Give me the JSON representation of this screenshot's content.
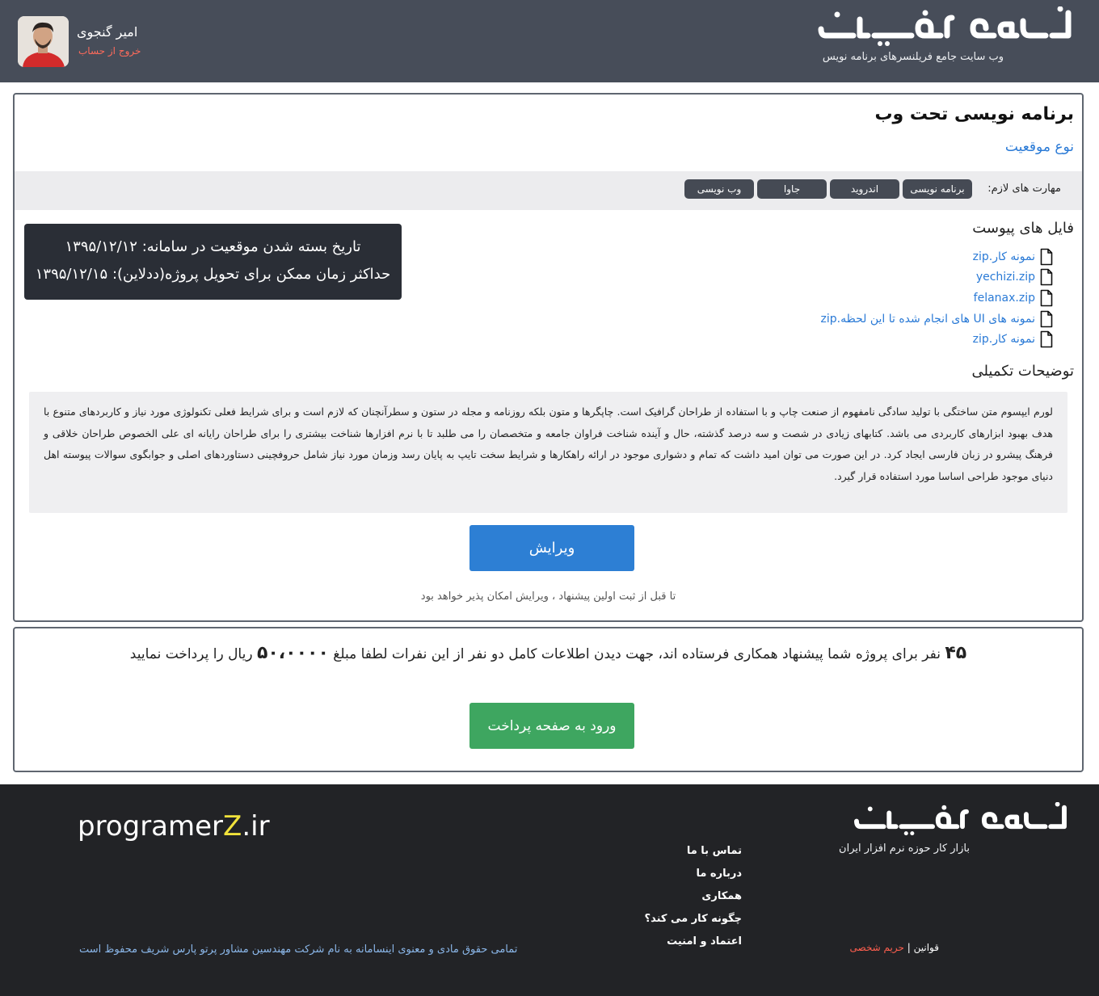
{
  "header": {
    "brand_logo_text": "برنامه نویسان",
    "tagline": "وب سایت جامع فریلنسرهای برنامه نویس",
    "user_name": "امیر گنجوی",
    "logout_label": "خروج از حساب"
  },
  "project": {
    "title": "برنامه نویسی تحت وب",
    "position_type": "نوع موقعیت",
    "skills_label": "مهارت های لازم:",
    "skills": [
      "برنامه نویسی",
      "اندروید",
      "جاوا",
      "وب نویسی"
    ],
    "close_date_line": "تاریخ بسته شدن موقعیت در سامانه: ۱۳۹۵/۱۲/۱۲",
    "deadline_line": "حداکثر زمان ممکن برای تحویل پروژه(ددلاین): ۱۳۹۵/۱۲/۱۵",
    "files_title": "فایل های پیوست",
    "files": [
      "نمونه کار.zip",
      "yechizi.zip",
      "felanax.zip",
      "نمونه های UI های انجام شده تا این لحظه.zip",
      "نمونه کار.zip"
    ],
    "notes_title": "توضیحات تکمیلی",
    "notes_text": "لورم ایپسوم متن ساختگی با تولید سادگی نامفهوم از صنعت چاپ و با استفاده از طراحان گرافیک است. چاپگرها و متون بلکه روزنامه و مجله در ستون و سطرآنچنان که لازم است و برای شرایط فعلی تکنولوژی مورد نیاز و کاربردهای متنوع با هدف بهبود ابزارهای کاربردی می باشد. کتابهای زیادی در شصت و سه درصد گذشته، حال و آینده شناخت فراوان جامعه و متخصصان را می طلبد تا با نرم افزارها شناخت بیشتری را برای طراحان رایانه ای علی الخصوص طراحان خلاقی و فرهنگ پیشرو در زبان فارسی ایجاد کرد. در این صورت می توان امید داشت که تمام و دشواری موجود در ارائه راهکارها و شرایط سخت تایپ به پایان رسد وزمان مورد نیاز شامل حروفچینی دستاوردهای اصلی و جوابگوی سوالات پیوسته اهل دنیای موجود طراحی اساسا مورد استفاده قرار گیرد.",
    "edit_label": "ویرایش",
    "edit_note": "تا قبل از ثبت اولین پیشنهاد ، ویرایش امکان پذیر خواهد بود"
  },
  "payment": {
    "count": "۴۵",
    "text_before_amount": "نفر برای پروژه شما پیشنهاد همکاری فرستاده اند، جهت دیدن اطلاعات کامل دو نفر از این نفرات لطفا مبلغ",
    "amount": "۵۰،۰۰۰۰",
    "text_after_amount": "ریال را پرداخت نمایید",
    "button_label": "ورود به صفحه پرداخت"
  },
  "footer": {
    "brand_logo_text": "برنامه نویسان",
    "tagline": "بازار کار حوزه نرم افزار ایران",
    "domain_prefix": "programer",
    "domain_accent": "Z",
    "domain_suffix": ".ir",
    "links": [
      "تماس با ما",
      "درباره ما",
      "همکاری",
      "چگونه کار می کند؟",
      "اعتماد و امنیت"
    ],
    "rules_label": "قوانین",
    "separator": "|",
    "privacy_label": "حریم شخصی",
    "copyright": "تمامی حقوق مادی و معنوی اینسامانه به نام شرکت مهندسین مشاور پرتو پارس شریف محفوظ است"
  },
  "colors": {
    "header_bg": "#474d59",
    "primary": "#2d7fd4",
    "success": "#3ea660",
    "danger": "#ff6b5b",
    "footer_bg": "#222326",
    "domain_accent": "#f1e23b"
  }
}
